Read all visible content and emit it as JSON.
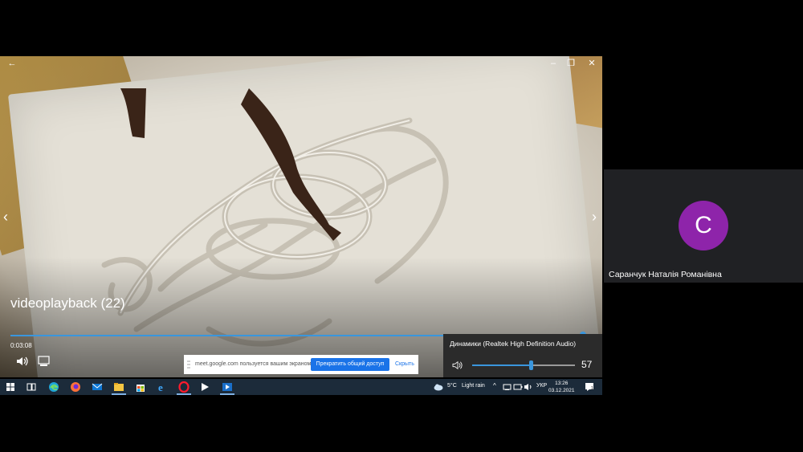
{
  "video": {
    "title": "videoplayback (22)",
    "elapsed": "0:03:08",
    "progress": 0.99
  },
  "volume_flyout": {
    "device": "Динамики (Realtek High Definition Audio)",
    "level": 57,
    "level_text": "57"
  },
  "share_banner": {
    "message": "meet.google.com пользуется вашим экраном.",
    "stop_label": "Прекратить общий доступ",
    "hide_label": "Скрыть"
  },
  "taskbar": {
    "weather_temp": "5°C",
    "weather_text": "Light rain",
    "language": "УКР",
    "time": "13:26",
    "date": "03.12.2021",
    "notification_count": "1",
    "apps": [
      "windows-start-icon",
      "task-view-icon",
      "edge-icon",
      "firefox-icon",
      "mail-icon",
      "file-explorer-icon",
      "store-icon",
      "internet-explorer-icon",
      "opera-icon",
      "media-player-icon",
      "movies-tv-icon"
    ]
  },
  "participant": {
    "initial": "С",
    "name": "Саранчук Наталія Романівна",
    "avatar_color": "#8e24aa"
  },
  "colors": {
    "accent": "#3a96dd",
    "taskbar": "#1c2b3a",
    "meet_button": "#1a73e8"
  }
}
